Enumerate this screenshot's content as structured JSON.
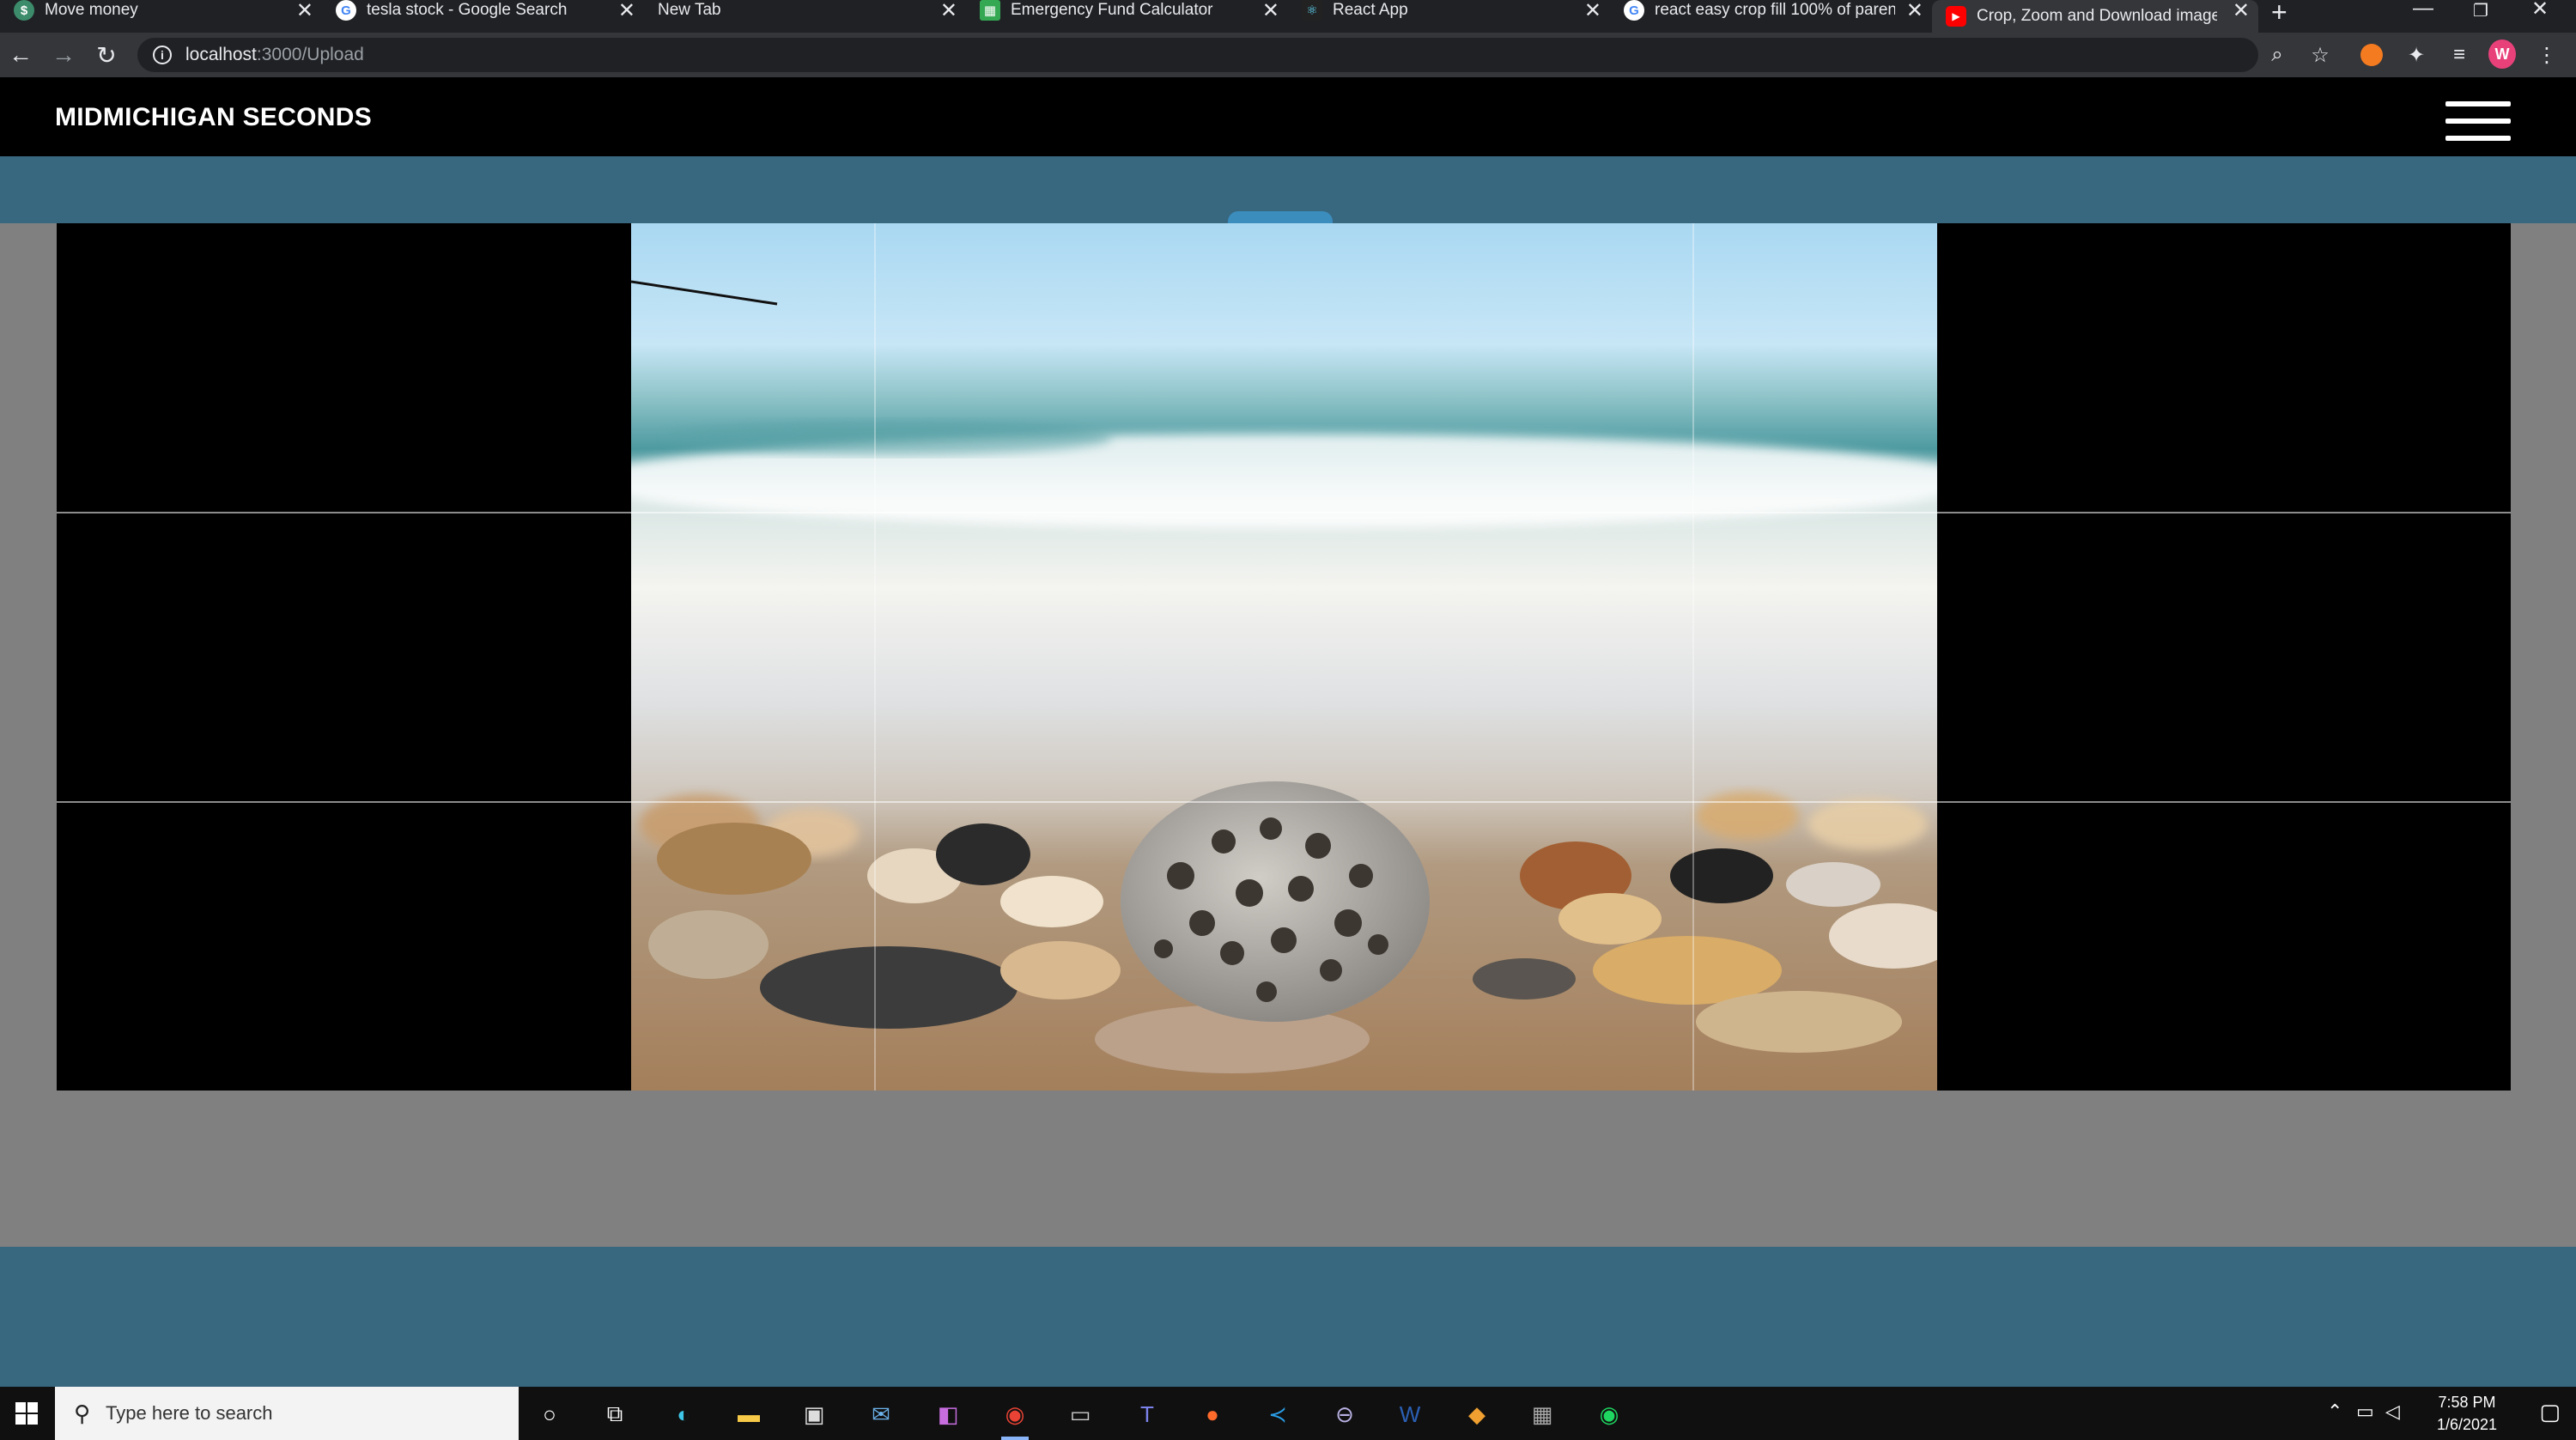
{
  "browser": {
    "tabs": [
      {
        "title": "Move money",
        "color": "#3c8c6c"
      },
      {
        "title": "tesla stock - Google Search",
        "color": "#4285f4"
      },
      {
        "title": "New Tab",
        "color": ""
      },
      {
        "title": "Emergency Fund Calculator",
        "color": "#34a853"
      },
      {
        "title": "React App",
        "color": "#61dafb"
      },
      {
        "title": "react easy crop fill 100% of parent",
        "color": "#4285f4"
      },
      {
        "title": "Crop, Zoom and Download images",
        "color": "#ff0000"
      }
    ],
    "close_glyph": "✕",
    "new_tab_glyph": "+",
    "url_host": "localhost",
    "url_path": ":3000/Upload"
  },
  "app": {
    "brand": "MIDMICHIGAN SECONDS"
  },
  "taskbar": {
    "search_placeholder": "Type here to search",
    "time": "7:58 PM",
    "date": "1/6/2021"
  },
  "colors": {
    "navbar": "#000000",
    "band": "#386780",
    "page_bg": "#808080",
    "accent_handle": "#3b8dbd"
  }
}
